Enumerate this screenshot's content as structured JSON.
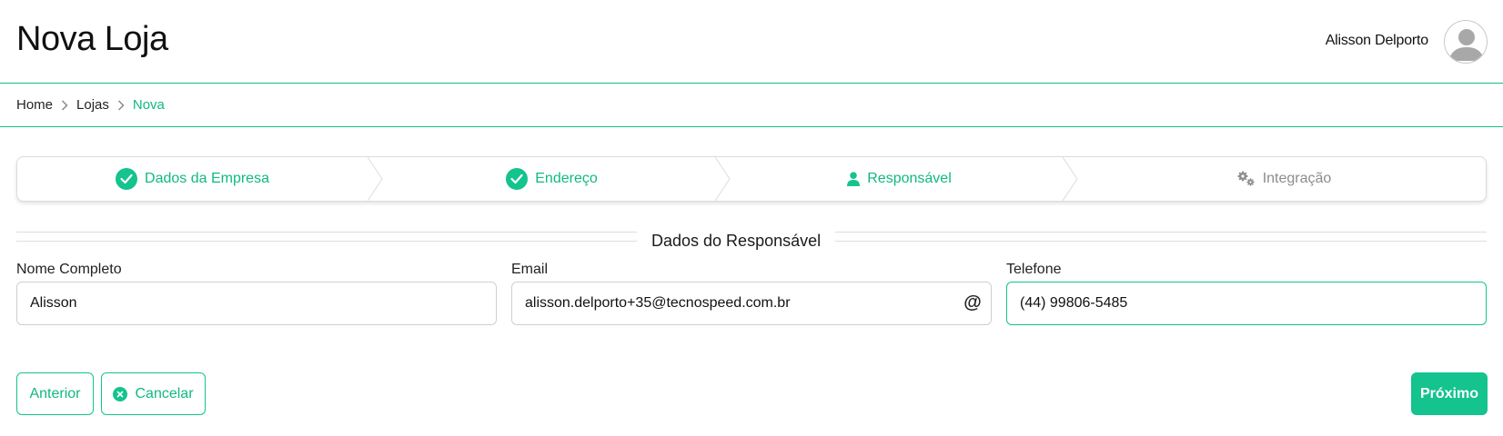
{
  "header": {
    "title": "Nova Loja",
    "user_name": "Alisson Delporto",
    "avatar_icon": "user-avatar-icon"
  },
  "breadcrumb": {
    "items": [
      "Home",
      "Lojas",
      "Nova"
    ],
    "separator_icon": "chevron-right-icon"
  },
  "stepper": {
    "steps": [
      {
        "label": "Dados da Empresa",
        "state": "done",
        "icon": "check-circle-icon"
      },
      {
        "label": "Endereço",
        "state": "done",
        "icon": "check-circle-icon"
      },
      {
        "label": "Responsável",
        "state": "current",
        "icon": "user-icon"
      },
      {
        "label": "Integração",
        "state": "todo",
        "icon": "gears-icon"
      }
    ]
  },
  "section": {
    "title": "Dados do Responsável"
  },
  "form": {
    "name_label": "Nome Completo",
    "name_value": "Alisson",
    "email_label": "Email",
    "email_value": "alisson.delporto+35@tecnospeed.com.br",
    "email_icon": "at-sign-icon",
    "phone_label": "Telefone",
    "phone_value": "(44) 99806-5485"
  },
  "actions": {
    "previous_label": "Anterior",
    "cancel_label": "Cancelar",
    "cancel_icon": "x-circle-icon",
    "next_label": "Próximo"
  },
  "colors": {
    "accent": "#14c38e",
    "accent_text": "#10b981",
    "inactive": "#8c8c8c"
  }
}
